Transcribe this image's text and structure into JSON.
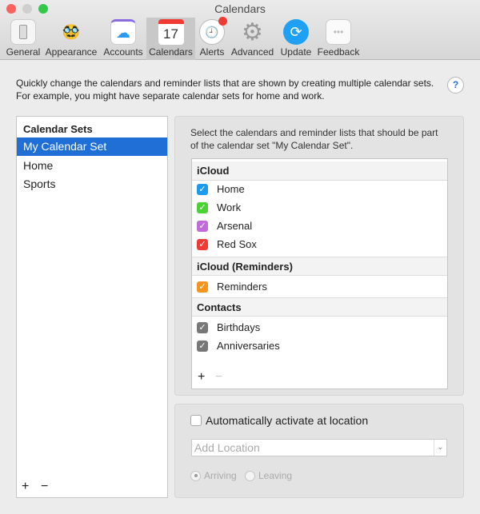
{
  "window": {
    "title": "Calendars"
  },
  "toolbar": [
    {
      "label": "General",
      "icon": "general-icon"
    },
    {
      "label": "Appearance",
      "icon": "appearance-icon"
    },
    {
      "label": "Accounts",
      "icon": "accounts-icon"
    },
    {
      "label": "Calendars",
      "icon": "calendar-icon",
      "selected": true,
      "icon_text": "17"
    },
    {
      "label": "Alerts",
      "icon": "alerts-icon"
    },
    {
      "label": "Advanced",
      "icon": "gear-icon"
    },
    {
      "label": "Update",
      "icon": "update-icon"
    },
    {
      "label": "Feedback",
      "icon": "feedback-icon"
    }
  ],
  "description": "Quickly change the calendars and reminder lists that are shown by creating multiple calendar sets. For example, you might have separate calendar sets for home and work.",
  "help": "?",
  "sets": {
    "header": "Calendar Sets",
    "items": [
      "My Calendar Set",
      "Home",
      "Sports"
    ],
    "selected": 0,
    "add": "+",
    "remove": "−"
  },
  "panel": {
    "text": "Select the calendars and reminder lists that should be part of the calendar set \"My Calendar Set\".",
    "groups": [
      {
        "name": "iCloud",
        "items": [
          {
            "label": "Home",
            "color": "#1a9bf0"
          },
          {
            "label": "Work",
            "color": "#4cd137"
          },
          {
            "label": "Arsenal",
            "color": "#c46bdc"
          },
          {
            "label": "Red Sox",
            "color": "#f03b35"
          }
        ]
      },
      {
        "name": "iCloud (Reminders)",
        "items": [
          {
            "label": "Reminders",
            "color": "#f7941d"
          }
        ]
      },
      {
        "name": "Contacts",
        "items": [
          {
            "label": "Birthdays",
            "color": "#777777"
          },
          {
            "label": "Anniversaries",
            "color": "#777777"
          }
        ]
      }
    ],
    "add": "+",
    "remove": "−"
  },
  "location": {
    "checkbox_label": "Automatically activate at location",
    "placeholder": "Add Location",
    "arriving": "Arriving",
    "leaving": "Leaving"
  }
}
